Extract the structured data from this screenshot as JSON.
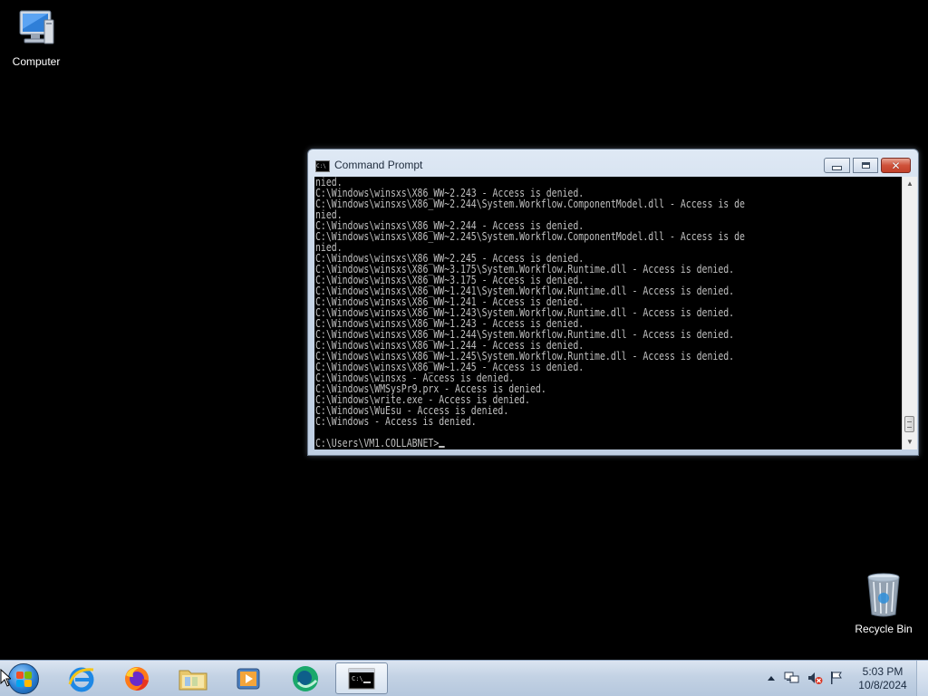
{
  "desktop": {
    "icons": [
      {
        "label": "Computer",
        "icon": "computer-icon"
      },
      {
        "label": "Recycle Bin",
        "icon": "recycle-bin-icon"
      }
    ]
  },
  "cmd_window": {
    "title": "Command Prompt",
    "icon_glyph": "C:\\",
    "lines": [
      "nied.",
      "C:\\Windows\\winsxs\\X86_WW~2.243 - Access is denied.",
      "C:\\Windows\\winsxs\\X86_WW~2.244\\System.Workflow.ComponentModel.dll - Access is de",
      "nied.",
      "C:\\Windows\\winsxs\\X86_WW~2.244 - Access is denied.",
      "C:\\Windows\\winsxs\\X86_WW~2.245\\System.Workflow.ComponentModel.dll - Access is de",
      "nied.",
      "C:\\Windows\\winsxs\\X86_WW~2.245 - Access is denied.",
      "C:\\Windows\\winsxs\\X86_WW~3.175\\System.Workflow.Runtime.dll - Access is denied.",
      "C:\\Windows\\winsxs\\X86_WW~3.175 - Access is denied.",
      "C:\\Windows\\winsxs\\X86_WW~1.241\\System.Workflow.Runtime.dll - Access is denied.",
      "C:\\Windows\\winsxs\\X86_WW~1.241 - Access is denied.",
      "C:\\Windows\\winsxs\\X86_WW~1.243\\System.Workflow.Runtime.dll - Access is denied.",
      "C:\\Windows\\winsxs\\X86_WW~1.243 - Access is denied.",
      "C:\\Windows\\winsxs\\X86_WW~1.244\\System.Workflow.Runtime.dll - Access is denied.",
      "C:\\Windows\\winsxs\\X86_WW~1.244 - Access is denied.",
      "C:\\Windows\\winsxs\\X86_WW~1.245\\System.Workflow.Runtime.dll - Access is denied.",
      "C:\\Windows\\winsxs\\X86_WW~1.245 - Access is denied.",
      "C:\\Windows\\winsxs - Access is denied.",
      "C:\\Windows\\WMSysPr9.prx - Access is denied.",
      "C:\\Windows\\write.exe - Access is denied.",
      "C:\\Windows\\WuEsu - Access is denied.",
      "C:\\Windows - Access is denied.",
      ""
    ],
    "prompt": "C:\\Users\\VM1.COLLABNET>",
    "colors": {
      "background": "#000000",
      "text": "#c0c0c0"
    }
  },
  "taskbar": {
    "pinned": [
      {
        "name": "start-button",
        "icon": "windows-orb-icon"
      },
      {
        "name": "internet-explorer",
        "icon": "internet-explorer-icon"
      },
      {
        "name": "firefox",
        "icon": "firefox-icon"
      },
      {
        "name": "windows-explorer",
        "icon": "folder-icon"
      },
      {
        "name": "media-player",
        "icon": "media-player-icon"
      },
      {
        "name": "app",
        "icon": "green-circle-icon"
      },
      {
        "name": "command-prompt",
        "icon": "cmd-icon",
        "active": true
      }
    ],
    "tray": {
      "icons": [
        "show-hidden-icons-arrow",
        "network-icon",
        "volume-muted-icon",
        "action-center-flag-icon"
      ],
      "time": "5:03 PM",
      "date": "10/8/2024"
    }
  }
}
